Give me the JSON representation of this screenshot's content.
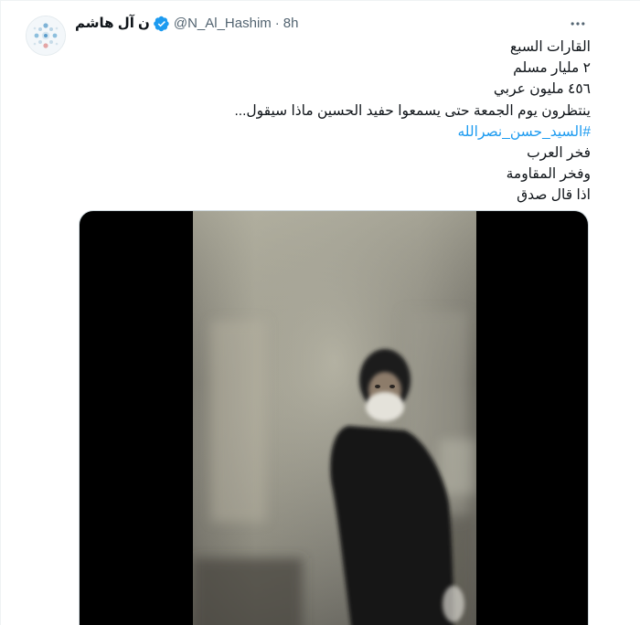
{
  "tweet": {
    "author": {
      "display_name": "ن آل هاشم",
      "handle": "@N_Al_Hashim",
      "verified": true,
      "avatar_icon": "avatar-image"
    },
    "separator": "·",
    "time": "8h",
    "more_icon": "more-dots-icon",
    "text_lines": [
      "القارات السبع",
      "٢ مليار مسلم",
      "٤٥٦ مليون  عربي",
      "ينتظرون يوم الجمعة حتى يسمعوا حفيد الحسين ماذا سيقول..."
    ],
    "hashtag": "#السيد_حسن_نصرالله",
    "text_lines_after": [
      "فخر العرب",
      "وفخر المقاومة",
      "اذا قال صدق"
    ],
    "media": {
      "type": "video"
    }
  },
  "colors": {
    "text": "#0f1419",
    "secondary": "#536471",
    "link": "#1d9bf0",
    "verified": "#1d9bf0",
    "border": "#cfd9de"
  }
}
